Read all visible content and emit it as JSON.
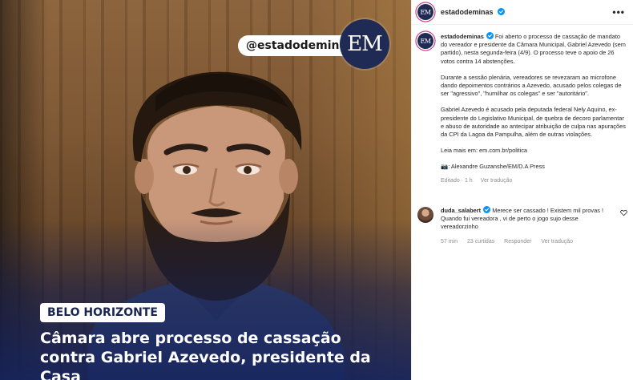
{
  "image": {
    "handle_badge": "@estadodeminas",
    "logo_text": "EM",
    "tag": "BELO HORIZONTE",
    "headline": "Câmara abre processo de cassação contra Gabriel Azevedo, presidente da Casa"
  },
  "header": {
    "avatar_text": "EM",
    "username": "estadodeminas",
    "more_icon": "more-horizontal-icon",
    "more_glyph": "•••"
  },
  "caption": {
    "username": "estadodeminas",
    "paragraphs": [
      "Foi aberto o processo de cassação de mandato do vereador e presidente da Câmara Municipal, Gabriel Azevedo (sem partido), nesta segunda-feira (4/9). O processo teve o apoio de 26 votos contra 14 abstenções.",
      "Durante a sessão plenária, vereadores se revezaram ao microfone dando depoimentos contrários a Azevedo, acusado pelos colegas de ser \"agressivo\", \"humilhar os colegas\" e ser \"autoritário\".",
      "Gabriel Azevedo é acusado pela deputada federal Nely Aquino, ex-presidente do Legislativo Municipal, de quebra de decoro parlamentar e abuso de autoridade ao antecipar atribuição de culpa nas apurações da CPI da Lagoa da Pampulha, além de outras violações.",
      "Leia mais em: em.com.br/politica",
      "📷: Alexandre Guzanshe/EM/D.A Press"
    ],
    "meta": {
      "edited": "Editado · 1 h",
      "translate": "Ver tradução"
    }
  },
  "comment": {
    "username": "duda_salabert",
    "text": "Merece ser cassado ! Existem mil provas ! Quando fui vereadora , vi de perto o jogo sujo desse vereadorzinho",
    "time": "57 min",
    "likes": "23 curtidas",
    "reply": "Responder",
    "translate": "Ver tradução"
  },
  "colors": {
    "brand_navy": "#1f2b55",
    "verified_blue": "#0095f6",
    "meta_gray": "#8e8e8e"
  }
}
